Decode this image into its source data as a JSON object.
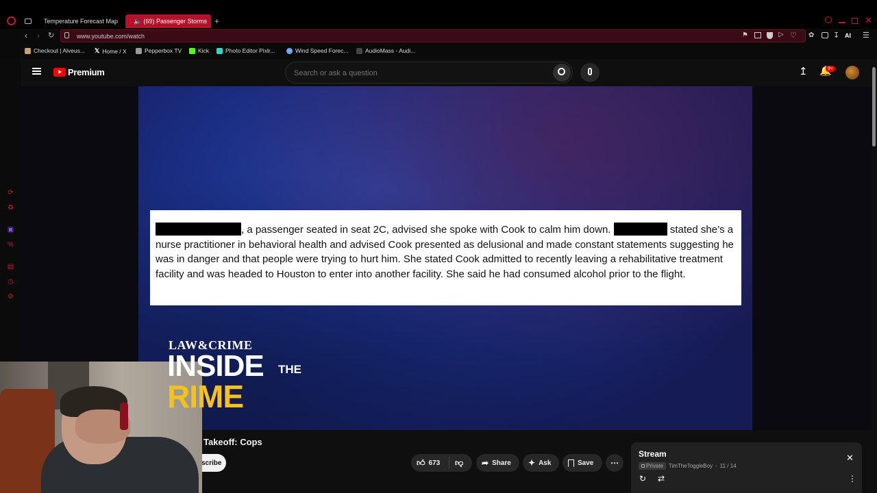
{
  "browser": {
    "tabs": [
      {
        "title": "Temperature Forecast Map",
        "active": false
      },
      {
        "title": "(69) Passenger Storms",
        "active": true
      }
    ],
    "url": "www.youtube.com/watch",
    "ai_label": "AI",
    "bookmarks": [
      {
        "label": "Checkout | Alveus...",
        "icon": "cat-icon",
        "color": "#c9a070"
      },
      {
        "label": "Home / X",
        "icon": "x-logo-icon",
        "color": "#ffffff"
      },
      {
        "label": "Pepperbox TV",
        "icon": "pepperbox-icon",
        "color": "#999999"
      },
      {
        "label": "Kick",
        "icon": "kick-icon",
        "color": "#53fc18"
      },
      {
        "label": "Photo Editor Pixlr...",
        "icon": "pixlr-icon",
        "color": "#3dd1c2"
      },
      {
        "label": "Wind Speed Forec...",
        "icon": "globe-icon",
        "color": "#6ea8ff"
      },
      {
        "label": "AudioMass - Audi...",
        "icon": "audiomass-icon",
        "color": "#444444"
      }
    ]
  },
  "youtube": {
    "logo_text": "Premium",
    "search_placeholder": "Search or ask a question",
    "notification_badge": "9+",
    "video": {
      "document_text": {
        "part1": ", a passenger seated in seat 2C, advised she spoke with Cook to calm him down.",
        "part2": "stated she’s a nurse practitioner in behavioral health and advised Cook presented as delusional and made constant statements suggesting he was in danger and that people were trying to hurt him. She stated Cook admitted to recently leaving a rehabilitative treatment facility and was headed to Houston to enter into another facility. She said he had consumed alcohol prior to the flight."
      },
      "logo": {
        "brand": "LAW&CRIME",
        "line1": "INSIDE",
        "line1b": "THE",
        "line2": "RIME"
      }
    },
    "title_partial": "Takeoff: Cops",
    "subscribe_partial": "scribe",
    "likes": "673",
    "actions": {
      "share": "Share",
      "ask": "Ask",
      "save": "Save"
    },
    "playlist": {
      "title": "Stream",
      "privacy": "Private",
      "owner": "TimTheToggleBoy",
      "position": "11 / 14"
    }
  },
  "colors": {
    "accent": "#b3122a",
    "yt_red": "#ff0000",
    "logo_yellow": "#f6c21a"
  }
}
